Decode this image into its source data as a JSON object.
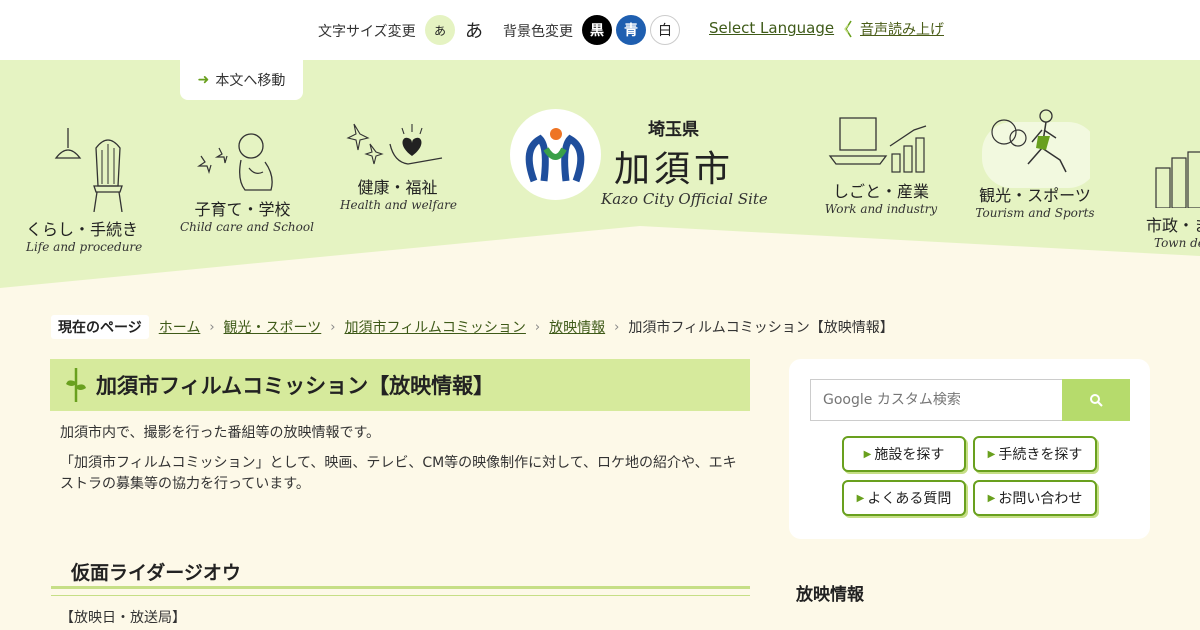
{
  "topbar": {
    "font_size_label": "文字サイズ変更",
    "font_small": "あ",
    "font_large": "あ",
    "bg_label": "背景色変更",
    "bg_black": "黒",
    "bg_blue": "青",
    "bg_white": "白",
    "language": "Select Language",
    "speech": "音声読み上げ"
  },
  "skip_link": "本文へ移動",
  "logo": {
    "prefecture": "埼玉県",
    "city": "加須市",
    "subtitle": "Kazo City Official Site"
  },
  "nav": [
    {
      "ja": "くらし・手続き",
      "en": "Life and procedure"
    },
    {
      "ja": "子育て・学校",
      "en": "Child care and School"
    },
    {
      "ja": "健康・福祉",
      "en": "Health and welfare"
    },
    {
      "ja": "しごと・産業",
      "en": "Work and industry"
    },
    {
      "ja": "観光・スポーツ",
      "en": "Tourism and Sports"
    },
    {
      "ja": "市政・ま",
      "en": "Town dev"
    }
  ],
  "breadcrumb": {
    "label": "現在のページ",
    "items": [
      "ホーム",
      "観光・スポーツ",
      "加須市フィルムコミッション",
      "放映情報"
    ],
    "current": "加須市フィルムコミッション【放映情報】"
  },
  "main": {
    "title": "加須市フィルムコミッション【放映情報】",
    "intro1": "加須市内で、撮影を行った番組等の放映情報です。",
    "intro2": "「加須市フィルムコミッション」として、映画、テレビ、CM等の映像制作に対して、ロケ地の紹介や、エキストラの募集等の協力を行っています。",
    "section_title": "仮面ライダージオウ",
    "broadcast_label": "【放映日・放送局】"
  },
  "sidebar": {
    "search_placeholder": "Google カスタム検索",
    "buttons": [
      "施設を探す",
      "手続きを探す",
      "よくある質問",
      "お問い合わせ"
    ],
    "section_title": "放映情報"
  },
  "colors": {
    "accent_green": "#69a01e",
    "band_green": "#e5f3c2",
    "cream": "#fdf9e8",
    "link": "#3e5a18"
  }
}
